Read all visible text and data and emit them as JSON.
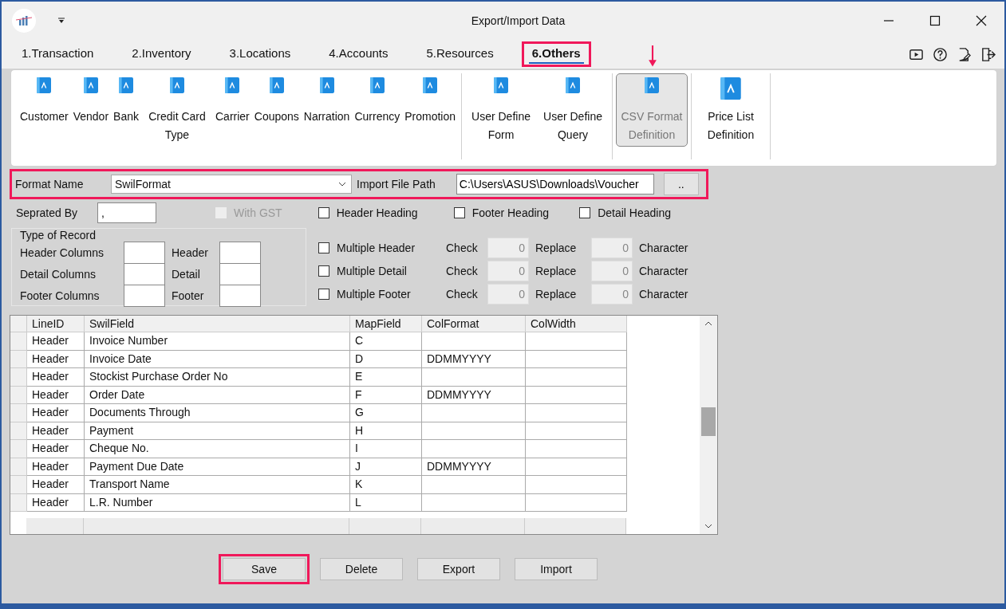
{
  "window": {
    "title": "Export/Import Data"
  },
  "tabs": [
    {
      "label": "1.Transaction",
      "selected": false,
      "highlighted": false
    },
    {
      "label": "2.Inventory",
      "selected": false,
      "highlighted": false
    },
    {
      "label": "3.Locations",
      "selected": false,
      "highlighted": false
    },
    {
      "label": "4.Accounts",
      "selected": false,
      "highlighted": false
    },
    {
      "label": "5.Resources",
      "selected": false,
      "highlighted": false
    },
    {
      "label": "6.Others",
      "selected": true,
      "highlighted": true
    }
  ],
  "ribbon": {
    "groups": [
      {
        "items": [
          {
            "label": "Customer",
            "selected": false,
            "arrow": false
          },
          {
            "label": "Vendor",
            "selected": false,
            "arrow": false
          },
          {
            "label": "Bank",
            "selected": false,
            "arrow": false
          },
          {
            "label": "Credit Card Type",
            "selected": false,
            "arrow": false
          },
          {
            "label": "Carrier",
            "selected": false,
            "arrow": false
          },
          {
            "label": "Coupons",
            "selected": false,
            "arrow": false
          },
          {
            "label": "Narration",
            "selected": false,
            "arrow": false
          },
          {
            "label": "Currency",
            "selected": false,
            "arrow": false
          },
          {
            "label": "Promotion",
            "selected": false,
            "arrow": false
          }
        ]
      },
      {
        "items": [
          {
            "label": "User Define Form",
            "selected": false,
            "arrow": false
          },
          {
            "label": "User Define Query",
            "selected": false,
            "arrow": false
          }
        ]
      },
      {
        "items": [
          {
            "label": "CSV Format Definition",
            "selected": true,
            "arrow": true
          }
        ]
      },
      {
        "items": [
          {
            "label": "Price List Definition",
            "selected": false,
            "arrow": false
          }
        ]
      }
    ]
  },
  "format_row": {
    "highlighted": true,
    "format_name_label": "Format Name",
    "format_name": "SwilFormat",
    "import_path_label": "Import File Path",
    "import_path": "C:\\Users\\ASUS\\Downloads\\Voucher",
    "browse_button": ".."
  },
  "separated_by": {
    "label": "Seprated By",
    "value": ","
  },
  "with_gst": {
    "label": "With GST",
    "checked": false,
    "disabled": true
  },
  "heading_options": [
    {
      "label": "Header Heading",
      "checked": false
    },
    {
      "label": "Footer Heading",
      "checked": false
    },
    {
      "label": "Detail Heading",
      "checked": false
    }
  ],
  "type_of_record": {
    "title": "Type of Record",
    "rows": [
      {
        "columns_label": "Header Columns",
        "type_label": "Header"
      },
      {
        "columns_label": "Detail Columns",
        "type_label": "Detail"
      },
      {
        "columns_label": "Footer Columns",
        "type_label": "Footer"
      }
    ]
  },
  "multiple_options": [
    {
      "label": "Multiple Header",
      "checked": false,
      "check_label": "Check",
      "check_value": "0",
      "replace_label": "Replace",
      "replace_value": "0",
      "character_label": "Character"
    },
    {
      "label": "Multiple Detail",
      "checked": false,
      "check_label": "Check",
      "check_value": "0",
      "replace_label": "Replace",
      "replace_value": "0",
      "character_label": "Character"
    },
    {
      "label": "Multiple Footer",
      "checked": false,
      "check_label": "Check",
      "check_value": "0",
      "replace_label": "Replace",
      "replace_value": "0",
      "character_label": "Character"
    }
  ],
  "table": {
    "columns": [
      "LineID",
      "SwilField",
      "MapField",
      "ColFormat",
      "ColWidth"
    ],
    "rows": [
      [
        "Header",
        "Invoice Number",
        "C",
        "",
        ""
      ],
      [
        "Header",
        "Invoice Date",
        "D",
        "DDMMYYYY",
        ""
      ],
      [
        "Header",
        "Stockist Purchase Order No",
        "E",
        "",
        ""
      ],
      [
        "Header",
        "Order Date",
        "F",
        "DDMMYYYY",
        ""
      ],
      [
        "Header",
        "Documents Through",
        "G",
        "",
        ""
      ],
      [
        "Header",
        "Payment",
        "H",
        "",
        ""
      ],
      [
        "Header",
        "Cheque No.",
        "I",
        "",
        ""
      ],
      [
        "Header",
        "Payment Due Date",
        "J",
        "DDMMYYYY",
        ""
      ],
      [
        "Header",
        "Transport Name",
        "K",
        "",
        ""
      ],
      [
        "Header",
        "L.R. Number",
        "L",
        "",
        ""
      ]
    ]
  },
  "buttons": [
    {
      "label": "Save",
      "highlighted": true
    },
    {
      "label": "Delete",
      "highlighted": false
    },
    {
      "label": "Export",
      "highlighted": false
    },
    {
      "label": "Import",
      "highlighted": false
    }
  ]
}
